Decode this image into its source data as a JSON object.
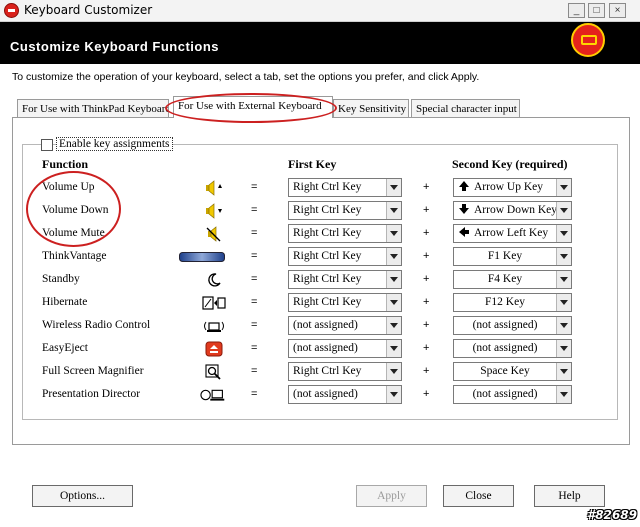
{
  "window": {
    "title": "Keyboard Customizer"
  },
  "header": {
    "title": "Customize Keyboard Functions",
    "badge_icon": "keyboard-icon",
    "badge_color": "#e4231c"
  },
  "description": "To customize the operation of your keyboard,  select a tab, set the options you prefer, and click Apply.",
  "tabs": [
    {
      "label": "For Use with ThinkPad Keyboard"
    },
    {
      "label": "For Use with External Keyboard"
    },
    {
      "label": "Key Sensitivity"
    },
    {
      "label": "Special character input"
    }
  ],
  "enable": {
    "label": "Enable key assignments",
    "checked": false
  },
  "columns": {
    "function": "Function",
    "first_key": "First Key",
    "second_key": "Second Key (required)"
  },
  "symbols": {
    "equals": "=",
    "plus": "+"
  },
  "rows": [
    {
      "function": "Volume Up",
      "icon": "volume-up-icon",
      "first_key": "Right Ctrl Key",
      "second_key": "Arrow Up Key",
      "second_icon": "arrow-up-icon"
    },
    {
      "function": "Volume Down",
      "icon": "volume-down-icon",
      "first_key": "Right Ctrl Key",
      "second_key": "Arrow Down Key",
      "second_icon": "arrow-down-icon"
    },
    {
      "function": "Volume Mute",
      "icon": "volume-mute-icon",
      "first_key": "Right Ctrl Key",
      "second_key": "Arrow Left Key",
      "second_icon": "arrow-left-icon"
    },
    {
      "function": "ThinkVantage",
      "icon": "thinkvantage-button-icon",
      "first_key": "Right Ctrl Key",
      "second_key": "F1 Key"
    },
    {
      "function": "Standby",
      "icon": "moon-icon",
      "first_key": "Right Ctrl Key",
      "second_key": "F4 Key"
    },
    {
      "function": "Hibernate",
      "icon": "hibernate-icon",
      "first_key": "Right Ctrl Key",
      "second_key": "F12 Key"
    },
    {
      "function": "Wireless Radio Control",
      "icon": "wireless-radio-icon",
      "first_key": "(not assigned)",
      "second_key": "(not assigned)"
    },
    {
      "function": "EasyEject",
      "icon": "easyeject-icon",
      "first_key": "(not assigned)",
      "second_key": "(not assigned)"
    },
    {
      "function": "Full Screen Magnifier",
      "icon": "magnifier-icon",
      "first_key": "Right Ctrl Key",
      "second_key": "Space Key"
    },
    {
      "function": "Presentation Director",
      "icon": "presentation-director-icon",
      "first_key": "(not assigned)",
      "second_key": "(not assigned)"
    }
  ],
  "buttons": {
    "options": "Options...",
    "apply": "Apply",
    "close": "Close",
    "help": "Help"
  },
  "watermark": "#82689"
}
